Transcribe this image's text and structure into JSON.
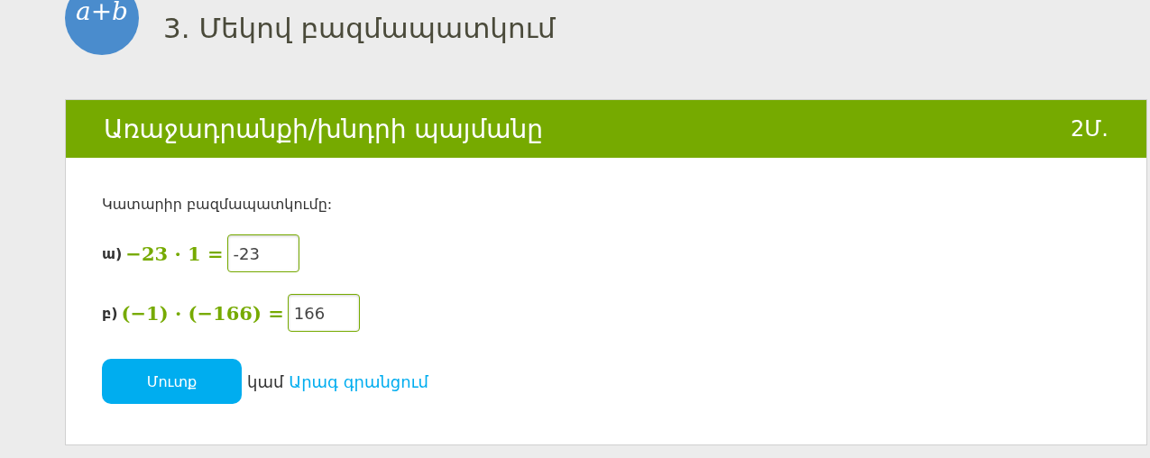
{
  "lesson": {
    "badge": "a+b",
    "title": "3. Մեկով բազմապատկում"
  },
  "task": {
    "title": "Առաջադրանքի/խնդրի պայմանը",
    "points": "2Մ.",
    "prompt": "Կատարիր բազմապատկումը:",
    "items": [
      {
        "label": "ա)",
        "expression": "−23 · 1 =",
        "answer": "-23"
      },
      {
        "label": "բ)",
        "expression": "(−1) · (−166) =",
        "answer": "166"
      }
    ],
    "submit": "Մուտք",
    "or": "կամ",
    "link": "Արագ գրանցում"
  }
}
